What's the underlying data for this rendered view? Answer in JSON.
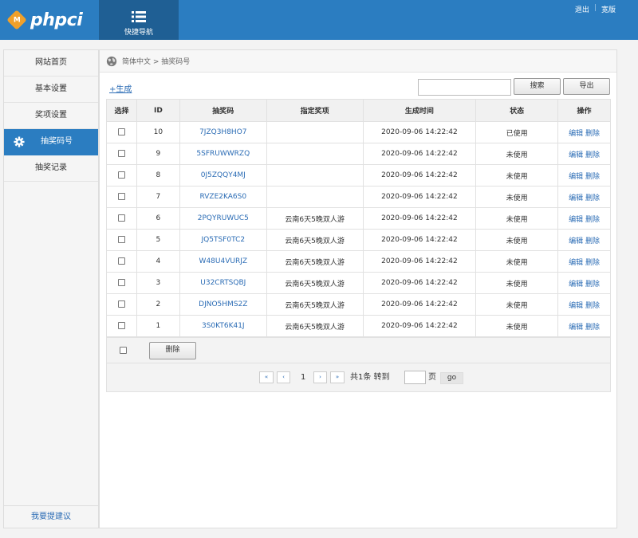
{
  "header": {
    "logo_badge": "M",
    "logo_text": "phpci",
    "quicknav_label": "快捷导航",
    "links": [
      "退出",
      "宽版"
    ],
    "link_sep": "|",
    "colors": {
      "bar": "#2b7dc1",
      "quicknav": "#1f5f94",
      "badge": "#f0a02a"
    }
  },
  "sidebar": {
    "items": [
      {
        "label": "网站首页",
        "active": false
      },
      {
        "label": "基本设置",
        "active": false
      },
      {
        "label": "奖项设置",
        "active": false
      },
      {
        "label": "抽奖码号",
        "active": true,
        "icon": "gear-icon"
      },
      {
        "label": "抽奖记录",
        "active": false
      }
    ],
    "footer_link": "我要提建议"
  },
  "breadcrumb": {
    "icon": "globe-icon",
    "text": "简体中文 > 抽奖码号"
  },
  "toolbar": {
    "generate_label": "+生成",
    "search_value": "",
    "search_label": "搜索",
    "export_label": "导出"
  },
  "table": {
    "headers": [
      "选择",
      "ID",
      "抽奖码",
      "指定奖项",
      "生成时间",
      "状态",
      "操作"
    ],
    "edit_label": "编辑",
    "delete_label": "删除",
    "rows": [
      {
        "id": "10",
        "code": "7JZQ3H8HO7",
        "prize": "",
        "time": "2020-09-06 14:22:42",
        "status": "已使用"
      },
      {
        "id": "9",
        "code": "5SFRUWWRZQ",
        "prize": "",
        "time": "2020-09-06 14:22:42",
        "status": "未使用"
      },
      {
        "id": "8",
        "code": "0J5ZQQY4MJ",
        "prize": "",
        "time": "2020-09-06 14:22:42",
        "status": "未使用"
      },
      {
        "id": "7",
        "code": "RVZE2KA6S0",
        "prize": "",
        "time": "2020-09-06 14:22:42",
        "status": "未使用"
      },
      {
        "id": "6",
        "code": "2PQYRUWUC5",
        "prize": "云南6天5晚双人游",
        "time": "2020-09-06 14:22:42",
        "status": "未使用"
      },
      {
        "id": "5",
        "code": "JQ5TSF0TC2",
        "prize": "云南6天5晚双人游",
        "time": "2020-09-06 14:22:42",
        "status": "未使用"
      },
      {
        "id": "4",
        "code": "W48U4VURJZ",
        "prize": "云南6天5晚双人游",
        "time": "2020-09-06 14:22:42",
        "status": "未使用"
      },
      {
        "id": "3",
        "code": "U32CRTSQBJ",
        "prize": "云南6天5晚双人游",
        "time": "2020-09-06 14:22:42",
        "status": "未使用"
      },
      {
        "id": "2",
        "code": "DJNO5HMS2Z",
        "prize": "云南6天5晚双人游",
        "time": "2020-09-06 14:22:42",
        "status": "未使用"
      },
      {
        "id": "1",
        "code": "3S0KT6K41J",
        "prize": "云南6天5晚双人游",
        "time": "2020-09-06 14:22:42",
        "status": "未使用"
      }
    ],
    "bulk_delete_label": "删除"
  },
  "pager": {
    "first": "«",
    "prev": "‹",
    "current_page": "1",
    "next": "›",
    "last": "»",
    "total_text": "共1条 转到",
    "page_input": "",
    "page_suffix": "页",
    "go_label": "go"
  }
}
